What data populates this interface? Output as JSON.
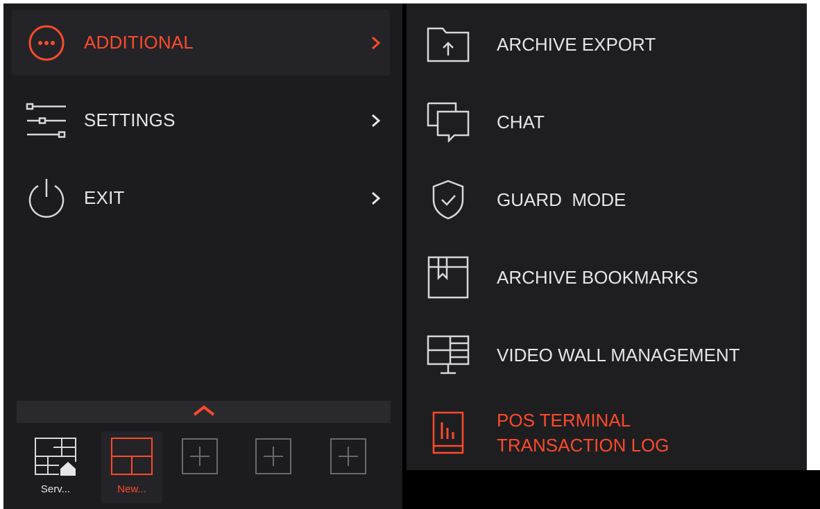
{
  "menu": {
    "items": [
      {
        "label": "ADDITIONAL",
        "icon": "more-circle-icon",
        "active": true
      },
      {
        "label": "SETTINGS",
        "icon": "sliders-icon",
        "active": false
      },
      {
        "label": "EXIT",
        "icon": "power-icon",
        "active": false
      }
    ]
  },
  "submenu": {
    "items": [
      {
        "label": "ARCHIVE EXPORT",
        "icon": "folder-upload-icon"
      },
      {
        "label": "CHAT",
        "icon": "chat-icon"
      },
      {
        "label": "GUARD  MODE",
        "icon": "shield-check-icon"
      },
      {
        "label": "ARCHIVE BOOKMARKS",
        "icon": "bookmark-icon"
      },
      {
        "label": "VIDEO WALL MANAGEMENT",
        "icon": "monitor-grid-icon"
      },
      {
        "label_line1": "POS TERMINAL",
        "label_line2": "TRANSACTION LOG",
        "icon": "receipt-chart-icon",
        "highlight": true
      }
    ]
  },
  "layouts": {
    "tabs": [
      {
        "caption": "Serv...",
        "icon": "grid-home-icon",
        "active": false
      },
      {
        "caption": "New...",
        "icon": "grid-layout-icon",
        "active": true
      }
    ],
    "add_buttons": 3
  },
  "colors": {
    "accent": "#ff4a2a",
    "text": "#e6e6e6",
    "panel": "#1c1c1f",
    "icon": "#d8d8d8"
  }
}
